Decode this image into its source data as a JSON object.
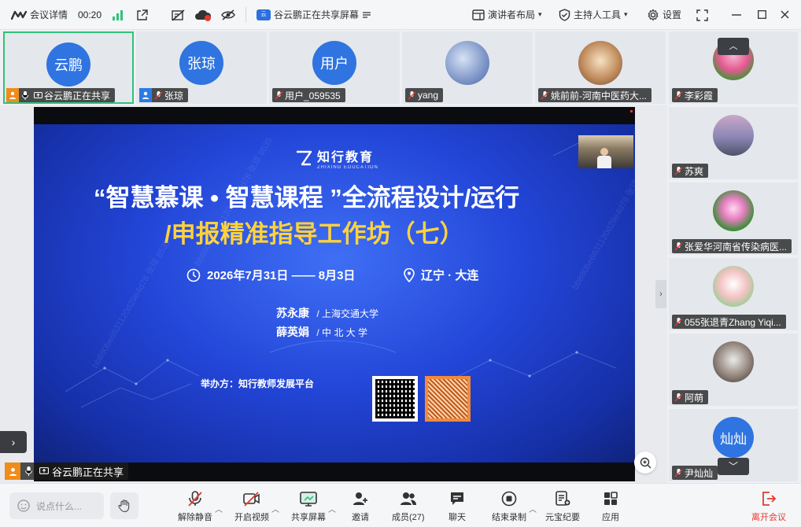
{
  "topbar": {
    "meeting_info": "会议详情",
    "timer": "00:20",
    "sharing_status": "谷云鹏正在共享屏幕",
    "layout": "演讲者布局",
    "host_tools": "主持人工具",
    "settings": "设置"
  },
  "tiles": [
    {
      "avatar_text": "云鹏",
      "name": "谷云鹏正在共享",
      "avatar_color": "#2f74e0"
    },
    {
      "avatar_text": "张琼",
      "name": "张琼",
      "avatar_color": "#2f74e0"
    },
    {
      "avatar_text": "用户",
      "name": "用户_059535",
      "avatar_color": "#2f74e0"
    },
    {
      "avatar_text": "",
      "name": "yang"
    },
    {
      "avatar_text": "",
      "name": "姚前前-河南中医药大..."
    }
  ],
  "right_tiles": [
    {
      "name": "李彩霞"
    },
    {
      "name": "苏爽"
    },
    {
      "name": "张爱华河南省传染病医..."
    },
    {
      "name": "055张退青Zhang Yiqi..."
    },
    {
      "name": "阿萌"
    },
    {
      "avatar_text": "灿灿",
      "name": "尹灿灿"
    }
  ],
  "slide": {
    "brand_cn": "知行教育",
    "brand_en": "ZHIXING EDUCATION",
    "title_line1": "“智慧慕课 • 智慧课程 ”全流程设计/运行",
    "title_line2": "/申报精准指导工作坊（七）",
    "date": "2026年7月31日 —— 8月3日",
    "location": "辽宁 · 大连",
    "speaker1_name": "苏永康",
    "speaker1_org": "/ 上海交通大学",
    "speaker2_name": "薛英娟",
    "speaker2_org": "/ 中 北 大 学",
    "organizer": "举办方：知行教师发展平台",
    "watermark": "bb880be6631120d29e4d78 张琼 8535"
  },
  "stage": {
    "sharer_label": "谷云鹏正在共享"
  },
  "bottombar": {
    "chat_placeholder": "说点什么...",
    "unmute": "解除静音",
    "start_video": "开启视频",
    "share_screen": "共享屏幕",
    "invite": "邀请",
    "members": "成员(27)",
    "chat": "聊天",
    "end_record": "结束录制",
    "yuanbao": "元宝纪要",
    "apps": "应用",
    "leave": "离开会议"
  },
  "colors": {
    "accent_green": "#2ec37c",
    "leave_red": "#e5392f",
    "avatar_blue": "#2f74e0",
    "slide_yellow": "#ffd23c"
  }
}
